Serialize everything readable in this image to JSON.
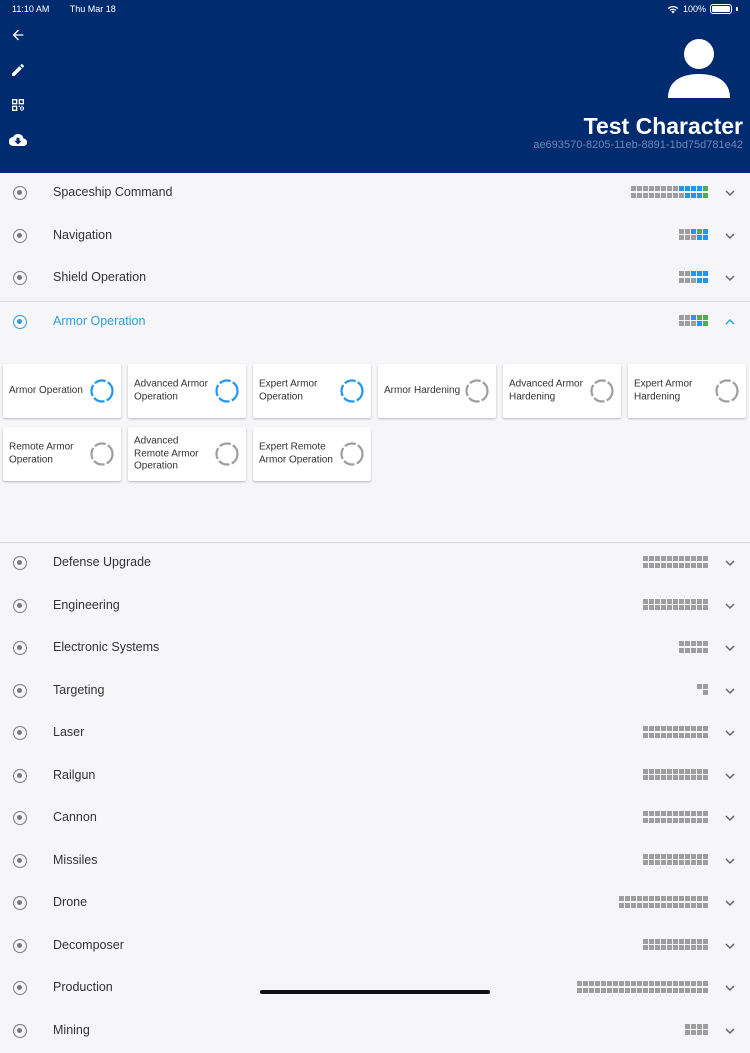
{
  "status": {
    "time": "11:10 AM",
    "date": "Thu Mar 18",
    "battery": "100%"
  },
  "header": {
    "icons": [
      "back-arrow-icon",
      "edit-pencil-icon",
      "qr-code-icon",
      "cloud-download-icon"
    ],
    "character_name": "Test Character",
    "character_id": "ae693570-8205-11eb-8891-1bd75d781e42",
    "bg_color": "#002b6e"
  },
  "colors": {
    "accent": "#2e9fd8",
    "trained": "#4caf50",
    "queued": "#2196f3",
    "untrained": "#9e9e9e"
  },
  "skills": [
    {
      "name": "Spaceship Command",
      "expanded": false,
      "pips": "ggbbbbbbbnnnnnnnnnnnnnnnnn"
    },
    {
      "name": "Navigation",
      "expanded": false,
      "pips": "bbgbbnnnnn"
    },
    {
      "name": "Shield Operation",
      "expanded": false,
      "pips": "bbbbbnnnnn"
    },
    {
      "name": "Armor Operation",
      "expanded": true,
      "pips": "gggbbnnnnn",
      "subskills": [
        {
          "name": "Armor Operation",
          "state": "active"
        },
        {
          "name": "Advanced Armor Operation",
          "state": "active"
        },
        {
          "name": "Expert Armor Operation",
          "state": "active"
        },
        {
          "name": "Armor Hardening",
          "state": "inactive"
        },
        {
          "name": "Advanced Armor Hardening",
          "state": "inactive"
        },
        {
          "name": "Expert Armor Hardening",
          "state": "inactive"
        },
        {
          "name": "Remote Armor Operation",
          "state": "inactive"
        },
        {
          "name": "Advanced Remote Armor Operation",
          "state": "inactive"
        },
        {
          "name": "Expert Remote Armor Operation",
          "state": "inactive"
        }
      ]
    },
    {
      "name": "Defense Upgrade",
      "expanded": false,
      "pips": "nnnnnnnnnnnnnnnnnnnnnn"
    },
    {
      "name": "Engineering",
      "expanded": false,
      "pips": "nnnnnnnnnnnnnnnnnnnnnn"
    },
    {
      "name": "Electronic Systems",
      "expanded": false,
      "pips": "nnnnnnnnnn"
    },
    {
      "name": "Targeting",
      "expanded": false,
      "pips": "nnn"
    },
    {
      "name": "Laser",
      "expanded": false,
      "pips": "nnnnnnnnnnnnnnnnnnnnnn"
    },
    {
      "name": "Railgun",
      "expanded": false,
      "pips": "nnnnnnnnnnnnnnnnnnnnnn"
    },
    {
      "name": "Cannon",
      "expanded": false,
      "pips": "nnnnnnnnnnnnnnnnnnnnnn"
    },
    {
      "name": "Missiles",
      "expanded": false,
      "pips": "nnnnnnnnnnnnnnnnnnnnnn"
    },
    {
      "name": "Drone",
      "expanded": false,
      "pips": "nnnnnnnnnnnnnnnnnnnnnnnnnnnnnn"
    },
    {
      "name": "Decomposer",
      "expanded": false,
      "pips": "nnnnnnnnnnnnnnnnnnnnnn"
    },
    {
      "name": "Production",
      "expanded": false,
      "pips": "nnnnnnnnnnnnnnnnnnnnnnnnnnnnnnnnnnnnnnnnnnnn"
    },
    {
      "name": "Mining",
      "expanded": false,
      "pips": "nnnnnnnn"
    }
  ]
}
